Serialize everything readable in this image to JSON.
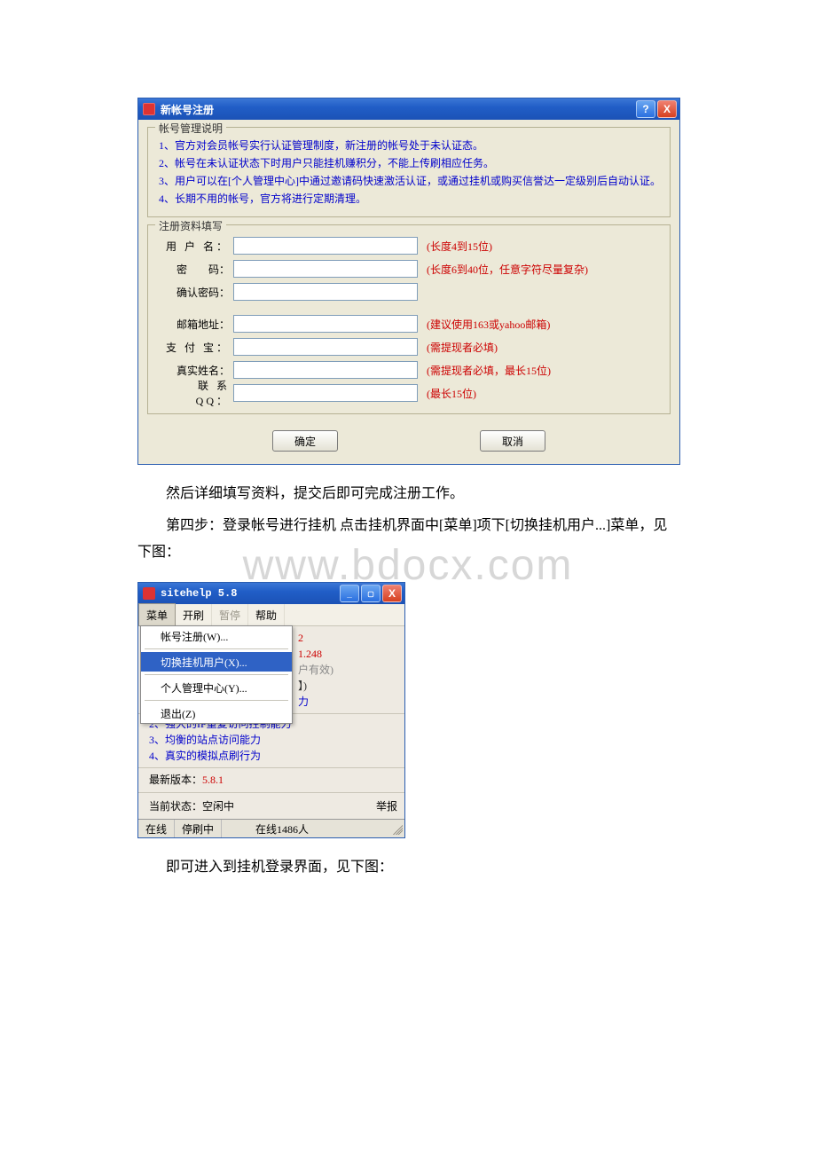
{
  "watermark": "www.bdocx.com",
  "dialog1": {
    "title": "新帐号注册",
    "helpGlyph": "?",
    "closeGlyph": "X",
    "group1Legend": "帐号管理说明",
    "rules": [
      "1、官方对会员帐号实行认证管理制度，新注册的帐号处于未认证态。",
      "2、帐号在未认证状态下时用户只能挂机赚积分，不能上传刷相应任务。",
      "3、用户可以在[个人管理中心]中通过邀请码快速激活认证，或通过挂机或购买信誉达一定级别后自动认证。",
      "4、长期不用的帐号，官方将进行定期清理。"
    ],
    "group2Legend": "注册资料填写",
    "fields": {
      "username": {
        "label": "用 户 名：",
        "hint": "(长度4到15位)"
      },
      "password": {
        "label": "密　　码：",
        "hint": "(长度6到40位，任意字符尽量复杂)"
      },
      "confirm": {
        "label": "确认密码：",
        "hint": ""
      },
      "email": {
        "label": "邮箱地址：",
        "hint": "(建议使用163或yahoo邮箱)"
      },
      "alipay": {
        "label": "支 付 宝：",
        "hint": "(需提现者必填)"
      },
      "realname": {
        "label": "真实姓名：",
        "hint": "(需提现者必填，最长15位)"
      },
      "qq": {
        "label": "联 系 QQ：",
        "hint": "(最长15位)"
      }
    },
    "ok": "确定",
    "cancel": "取消"
  },
  "para1": "然后详细填写资料，提交后即可完成注册工作。",
  "para2": "第四步：登录帐号进行挂机 点击挂机界面中[菜单]项下[切换挂机用户...]菜单，见下图：",
  "dialog2": {
    "title": "sitehelp 5.8",
    "menubar": {
      "menu": "菜单",
      "start": "开刷",
      "pause": "暂停",
      "help": "帮助"
    },
    "dropdown": {
      "register": "帐号注册(W)...",
      "switch": "切换挂机用户(X)...",
      "center": "个人管理中心(Y)...",
      "exit": "退出(Z)"
    },
    "peek": {
      "l1": "2",
      "l2": "1.248",
      "l3": "户有效)",
      "l4": "】)",
      "l5": "力"
    },
    "features": [
      "2、强大的IP重复访问控制能力",
      "3、均衡的站点访问能力",
      "4、真实的模拟点刷行为"
    ],
    "versionLabel": "最新版本：",
    "versionValue": "5.8.1",
    "stateLabel": "当前状态：空闲中",
    "report": "举报",
    "status": {
      "online": "在线",
      "paused": "停刷中",
      "count": "在线1486人"
    }
  },
  "para3": "即可进入到挂机登录界面，见下图："
}
